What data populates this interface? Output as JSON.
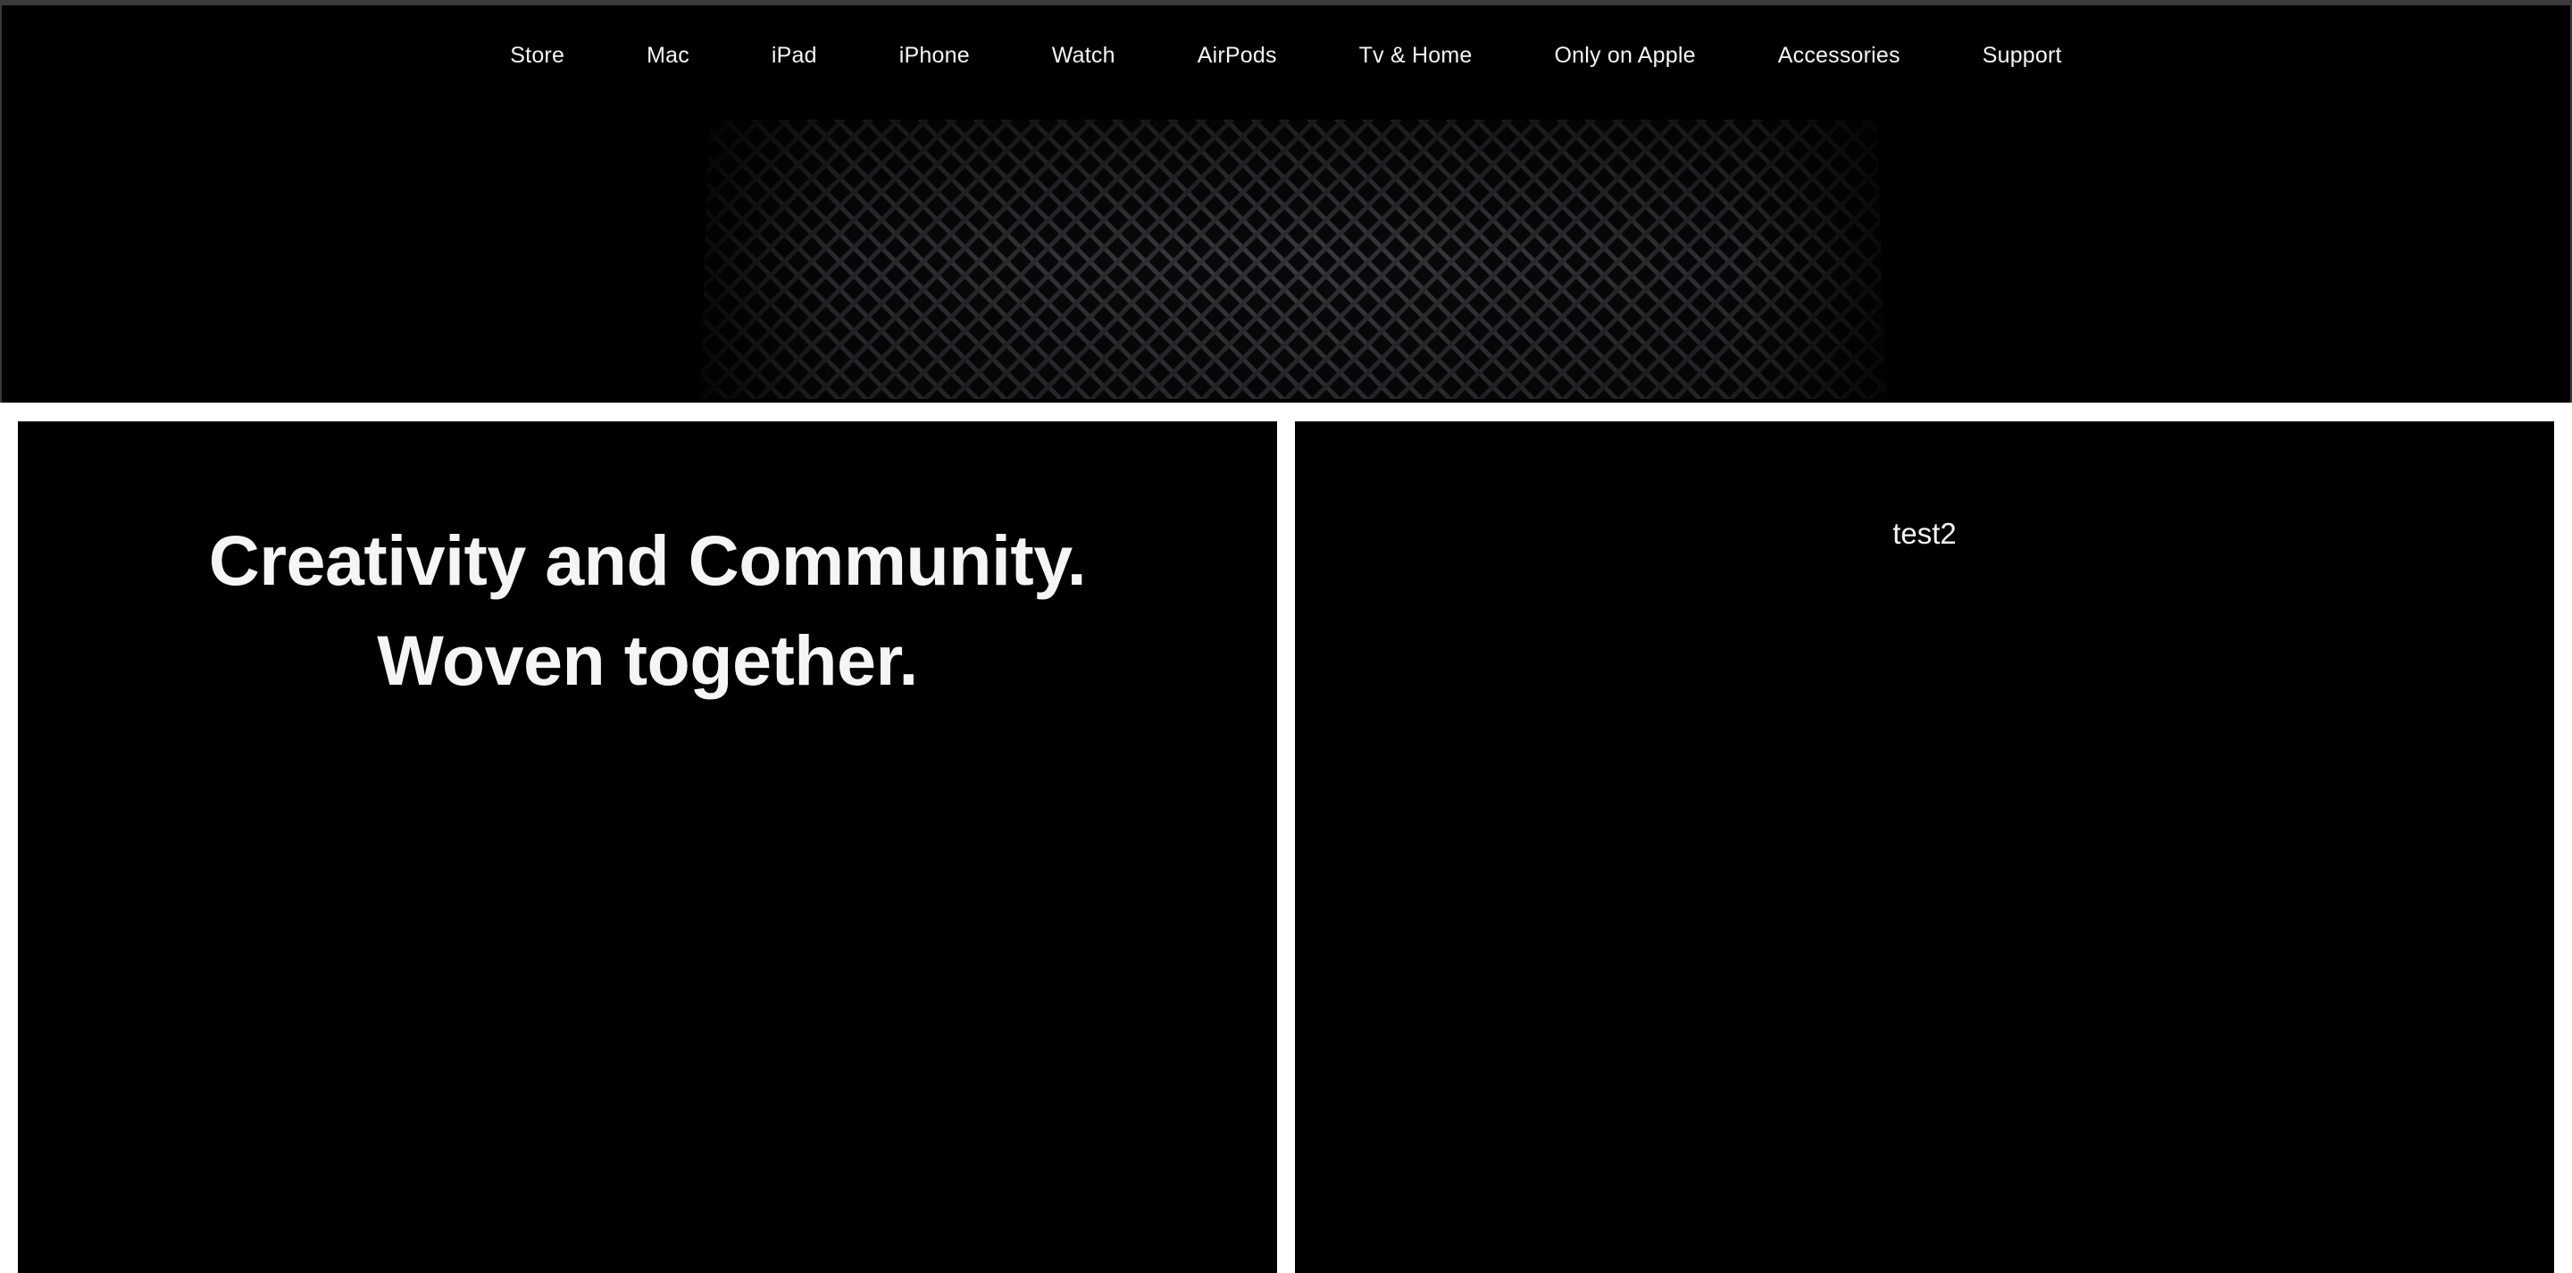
{
  "nav": {
    "items": [
      {
        "label": "Store"
      },
      {
        "label": "Mac"
      },
      {
        "label": "iPad"
      },
      {
        "label": "iPhone"
      },
      {
        "label": "Watch"
      },
      {
        "label": "AirPods"
      },
      {
        "label": "Tv & Home"
      },
      {
        "label": "Only on Apple"
      },
      {
        "label": "Accessories"
      },
      {
        "label": "Support"
      }
    ]
  },
  "hero": {
    "image": "homepod-mesh-image"
  },
  "panels": {
    "left": {
      "headline_line1": "Creativity and Community.",
      "headline_line2": "Woven together."
    },
    "right": {
      "text": "test2"
    }
  },
  "colors": {
    "page_background": "#ffffff",
    "panel_background": "#000000",
    "text": "#f5f5f7",
    "frame_border": "#3a3a3c"
  }
}
